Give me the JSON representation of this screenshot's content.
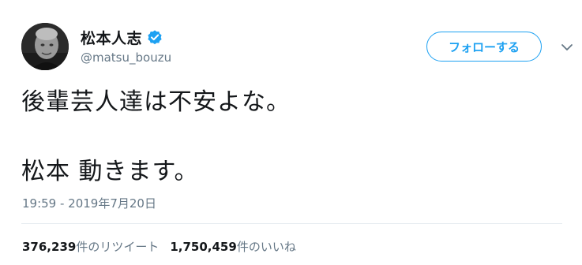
{
  "user": {
    "display_name": "松本人志",
    "handle": "@matsu_bouzu",
    "verified": true,
    "avatar_icon": "profile-photo"
  },
  "actions": {
    "follow_label": "フォローする",
    "menu_icon": "chevron-down-icon"
  },
  "tweet": {
    "lines": [
      "後輩芸人達は不安よな。",
      "",
      "松本 動きます。"
    ]
  },
  "meta": {
    "timestamp": "19:59 - 2019年7月20日"
  },
  "stats": {
    "retweets_count": "376,239",
    "retweets_label": "件のリツイート",
    "likes_count": "1,750,459",
    "likes_label": "件のいいね"
  },
  "colors": {
    "accent": "#1da1f2",
    "secondary_text": "#657786",
    "primary_text": "#14171a",
    "divider": "#e6ecf0"
  }
}
